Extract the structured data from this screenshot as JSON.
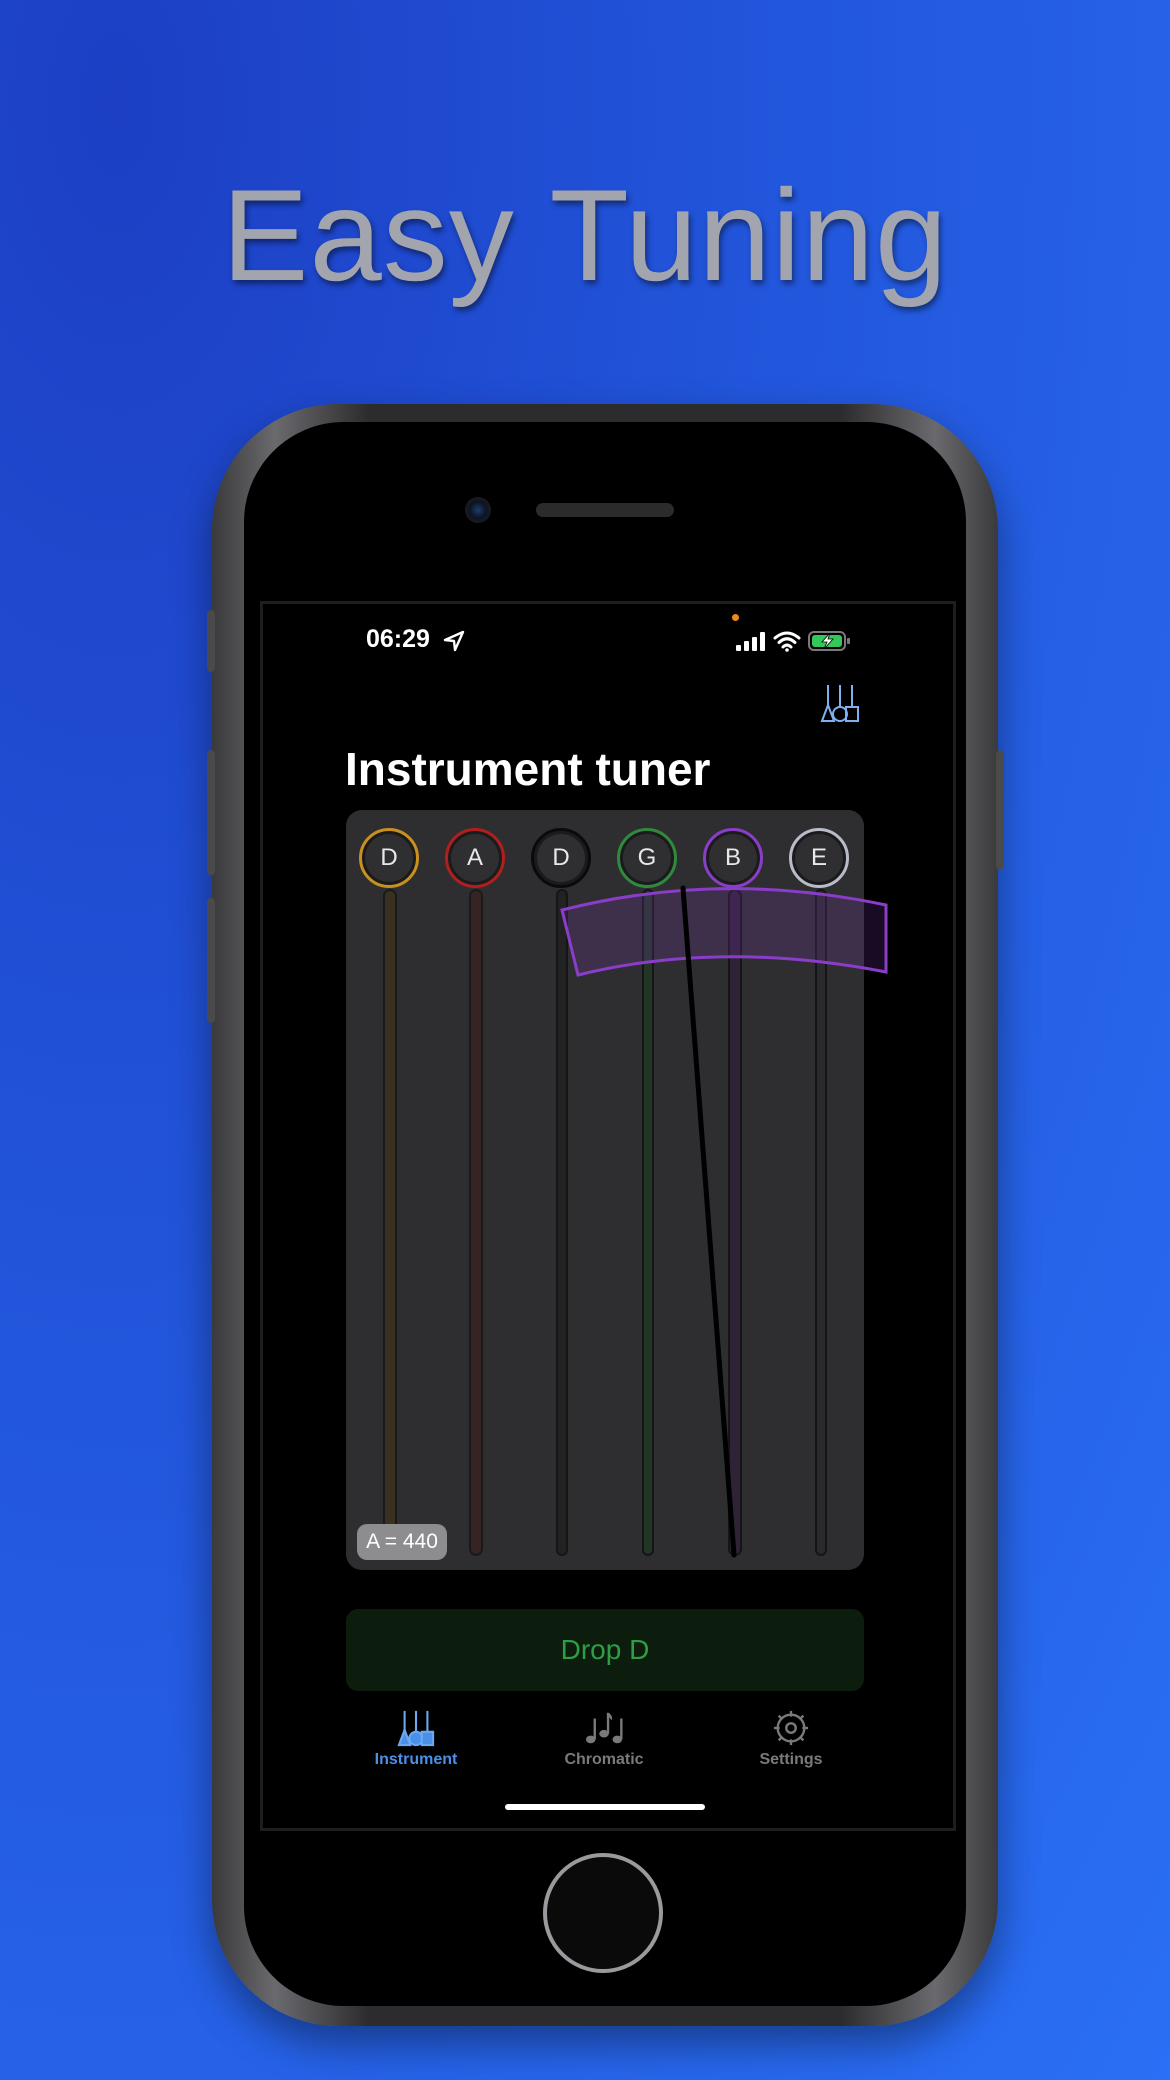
{
  "headline": "Easy Tuning",
  "status_bar": {
    "time": "06:29"
  },
  "app": {
    "title": "Instrument tuner",
    "reference_pitch": "A = 440",
    "tuning_preset": "Drop D"
  },
  "strings": [
    {
      "note": "D",
      "color": "#c8901e"
    },
    {
      "note": "A",
      "color": "#b01e1e"
    },
    {
      "note": "D",
      "color": "#111111"
    },
    {
      "note": "G",
      "color": "#2f8a3e"
    },
    {
      "note": "B",
      "color": "#8a3dc8"
    },
    {
      "note": "E",
      "color": "#b8bcc8"
    }
  ],
  "tabs": [
    {
      "label": "Instrument",
      "icon": "instrument-icon",
      "active": true
    },
    {
      "label": "Chromatic",
      "icon": "music-notes-icon",
      "active": false
    },
    {
      "label": "Settings",
      "icon": "gear-icon",
      "active": false
    }
  ],
  "colors": {
    "background": "#2256dc",
    "accent_active_tab": "#4a90e8",
    "inactive_tab": "#7a7a7c",
    "preset_text": "#2e9e45"
  }
}
